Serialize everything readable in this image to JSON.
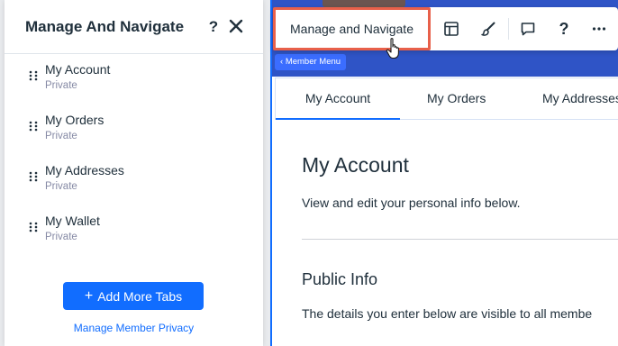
{
  "panel": {
    "title": "Manage And Navigate",
    "help_label": "?",
    "items": [
      {
        "label": "My Account",
        "sub": "Private"
      },
      {
        "label": "My Orders",
        "sub": "Private"
      },
      {
        "label": "My Addresses",
        "sub": "Private"
      },
      {
        "label": "My Wallet",
        "sub": "Private"
      }
    ],
    "add_button": "Add More Tabs",
    "add_icon": "+",
    "privacy_link": "Manage Member Privacy"
  },
  "toolbar": {
    "main_label": "Manage and Navigate",
    "help_label": "?",
    "icons": [
      "layout-icon",
      "brush-icon",
      "comment-icon",
      "help-icon",
      "more-icon"
    ]
  },
  "canvas": {
    "member_menu_tag": "Member Menu",
    "tag_chevron": "‹",
    "tabs": [
      "My Account",
      "My Orders",
      "My Addresses"
    ],
    "active_tab": "My Account",
    "title": "My Account",
    "subtitle": "View and edit your personal info below.",
    "section_title": "Public Info",
    "section_text": "The details you enter below are visible to all membe"
  },
  "colors": {
    "accent": "#116dff",
    "highlight": "#e8604a",
    "site_header": "#2f54c6",
    "text": "#20303c",
    "muted": "#868aa5"
  }
}
